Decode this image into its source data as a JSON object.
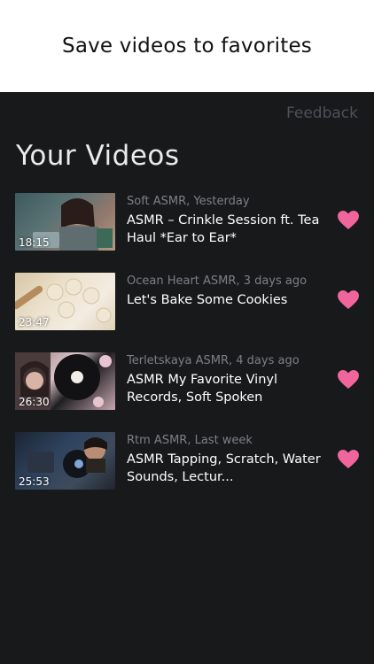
{
  "banner": {
    "text": "Save videos to favorites"
  },
  "header": {
    "feedback_label": "Feedback",
    "title": "Your Videos"
  },
  "colors": {
    "heart": "#f0669c",
    "background": "#17191b",
    "muted_text": "#7c8086"
  },
  "videos": [
    {
      "duration": "18:15",
      "channel_time": "Soft ASMR, Yesterday",
      "title": "ASMR – Crinkle Session ft. Tea Haul *Ear to Ear*",
      "favorite_icon": "heart-icon"
    },
    {
      "duration": "23:47",
      "channel_time": "Ocean Heart ASMR, 3 days ago",
      "title": "Let's Bake Some Cookies",
      "favorite_icon": "heart-icon"
    },
    {
      "duration": "26:30",
      "channel_time": "Terletskaya ASMR, 4 days ago",
      "title": "ASMR My Favorite Vinyl Records, Soft Spoken",
      "favorite_icon": "heart-icon"
    },
    {
      "duration": "25:53",
      "channel_time": "Rtm ASMR, Last week",
      "title": "ASMR Tapping, Scratch, Water Sounds, Lectur...",
      "favorite_icon": "heart-icon"
    }
  ]
}
